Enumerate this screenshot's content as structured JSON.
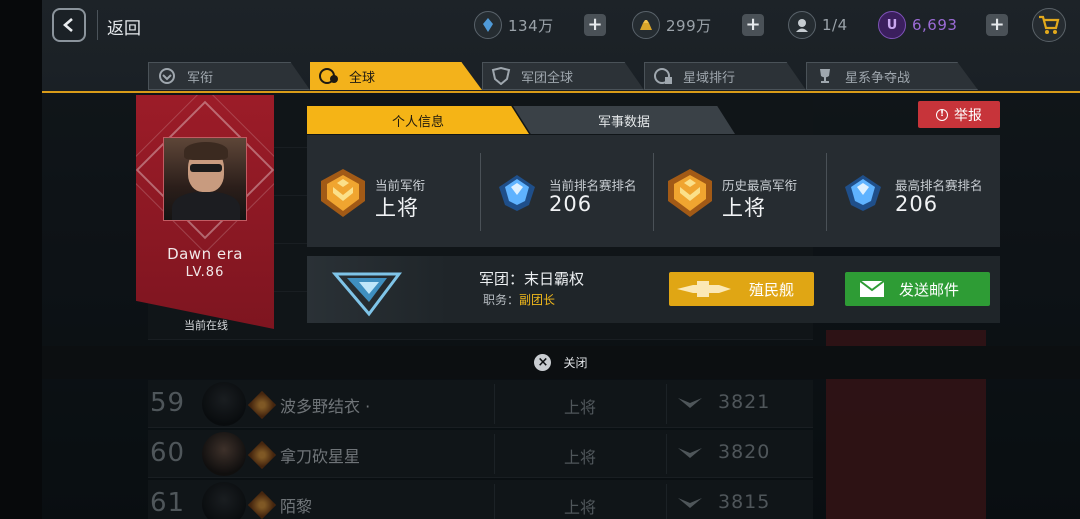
{
  "topbar": {
    "back_label": "返回",
    "resources": [
      {
        "icon": "crystal-icon",
        "value": "134万"
      },
      {
        "icon": "gold-bar-icon",
        "value": "299万"
      },
      {
        "icon": "commander-icon",
        "value": "1/4"
      },
      {
        "icon": "u-coin-icon",
        "value": "6,693"
      }
    ],
    "cart_icon": "shopping-cart-icon"
  },
  "tabs": [
    {
      "label": "军衔",
      "icon": "rank-icon",
      "active": false
    },
    {
      "label": "全球",
      "icon": "globe-icon",
      "active": true
    },
    {
      "label": "军团全球",
      "icon": "legion-icon",
      "active": false
    },
    {
      "label": "星域排行",
      "icon": "galaxy-icon",
      "active": false
    },
    {
      "label": "星系争夺战",
      "icon": "trophy-icon",
      "active": false
    }
  ],
  "rank_list": [
    {
      "rank": "59",
      "name": "波多野结衣 ·",
      "title": "上将",
      "score": "3821"
    },
    {
      "rank": "60",
      "name": "拿刀砍星星",
      "title": "上将",
      "score": "3820"
    },
    {
      "rank": "61",
      "name": "陌黎",
      "title": "上将",
      "score": "3815"
    }
  ],
  "player": {
    "name": "Dawn era",
    "level": "LV.86",
    "status": "当前在线"
  },
  "info_panel": {
    "tabs": [
      "个人信息",
      "军事数据"
    ],
    "report_label": "举报",
    "stats": [
      {
        "label": "当前军衔",
        "value": "上将",
        "icon": "gold-rank-badge-icon"
      },
      {
        "label": "当前排名赛排名",
        "value": "206",
        "icon": "blue-crystal-badge-icon"
      },
      {
        "label": "历史最高军衔",
        "value": "上将",
        "icon": "gold-rank-badge-icon"
      },
      {
        "label": "最高排名赛排名",
        "value": "206",
        "icon": "blue-crystal-badge-icon"
      }
    ],
    "legion": {
      "name": "军团：末日霸权",
      "role_label": "职务：",
      "role": "副团长"
    },
    "colony_label": "殖民舰",
    "mail_label": "发送邮件"
  },
  "close_label": "关闭",
  "colors": {
    "accent_yellow": "#f5b416",
    "report_red": "#c7343a",
    "mail_green": "#2e9c35",
    "card_red": "#9c1c28"
  }
}
